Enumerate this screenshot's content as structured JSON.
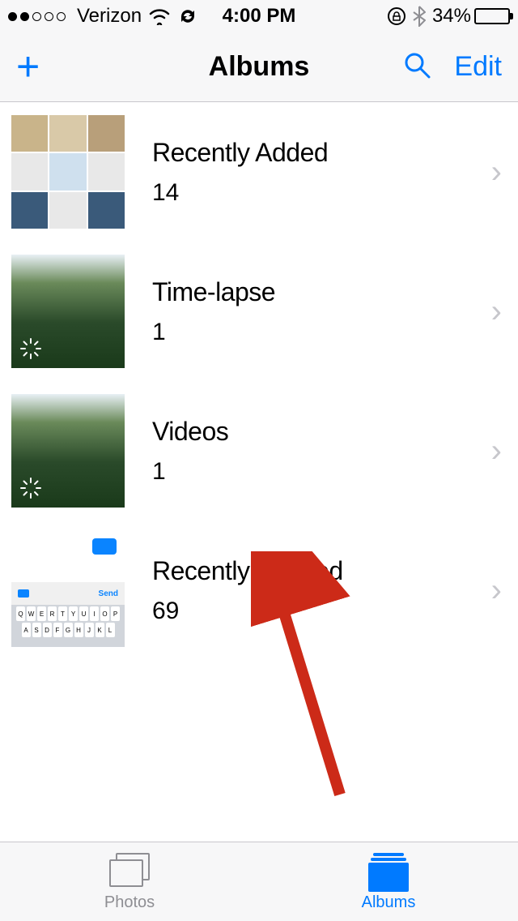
{
  "status": {
    "carrier": "Verizon",
    "time": "4:00 PM",
    "battery_pct": "34%",
    "battery_fill": 34
  },
  "nav": {
    "title": "Albums",
    "edit": "Edit"
  },
  "albums": [
    {
      "title": "Recently Added",
      "count": "14"
    },
    {
      "title": "Time-lapse",
      "count": "1"
    },
    {
      "title": "Videos",
      "count": "1"
    },
    {
      "title": "Recently Deleted",
      "count": "69"
    }
  ],
  "tabs": {
    "photos": "Photos",
    "albums": "Albums"
  },
  "keyboard_rows": [
    "QWERTYUIOP",
    "ASDFGHJKL"
  ]
}
